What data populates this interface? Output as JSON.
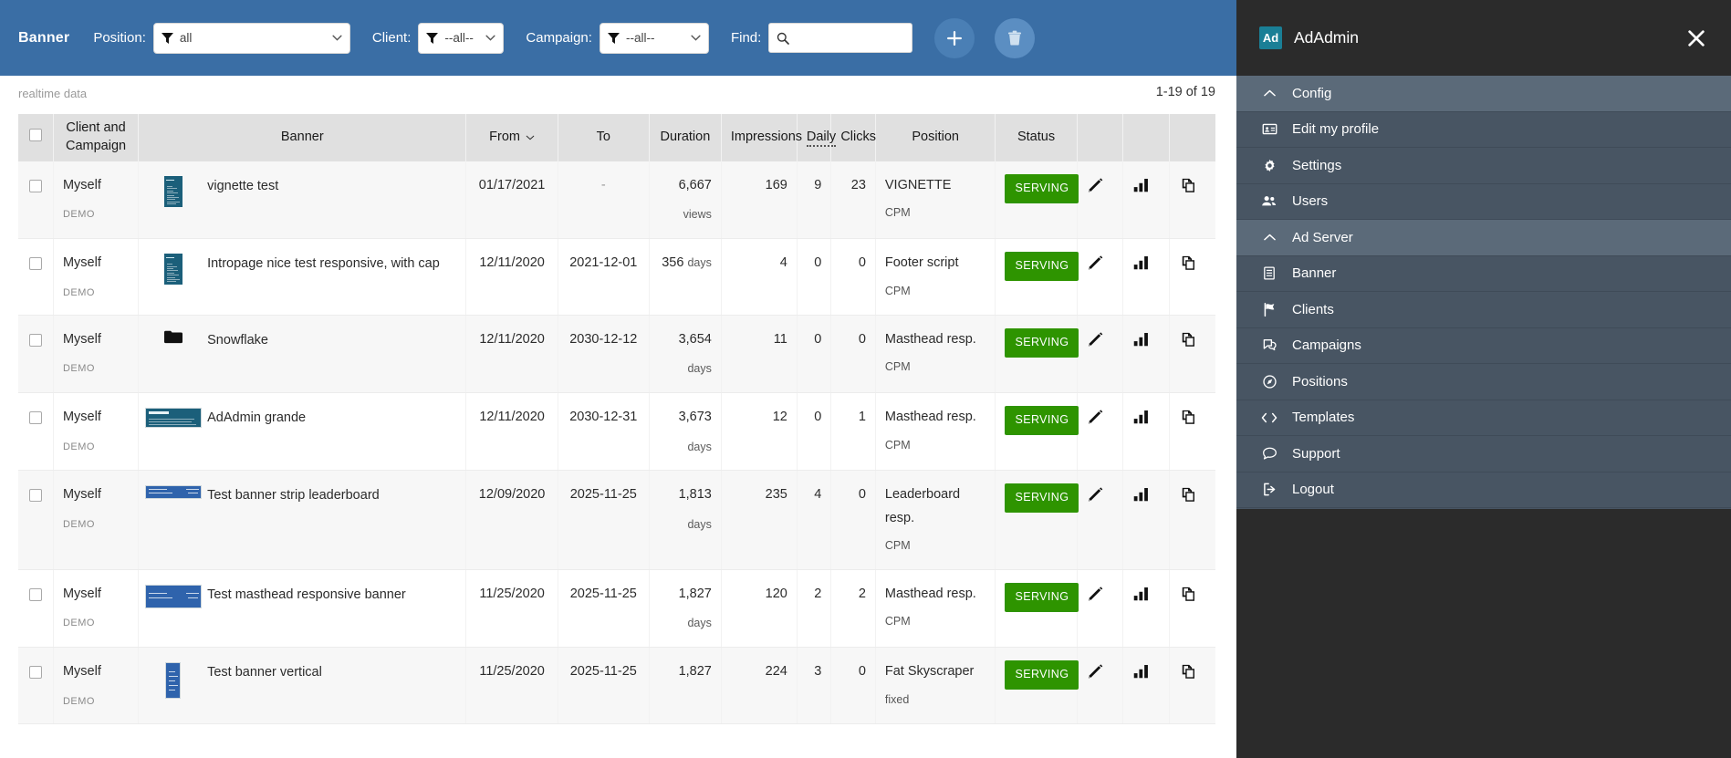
{
  "toolbar": {
    "title": "Banner",
    "position_label": "Position:",
    "position_value": "all",
    "client_label": "Client:",
    "client_value": "--all--",
    "campaign_label": "Campaign:",
    "campaign_value": "--all--",
    "find_label": "Find:",
    "find_value": "",
    "find_placeholder": "",
    "add_button": "+",
    "accent": "#3a6ea5"
  },
  "subheader": {
    "realtime": "realtime data",
    "pageinfo": "1-19 of 19"
  },
  "table": {
    "headers": {
      "client": "Client and Campaign",
      "client_line1": "Client and",
      "client_line2": "Campaign",
      "banner": "Banner",
      "from": "From",
      "to": "To",
      "duration": "Duration",
      "impressions": "Impressions",
      "daily": "Daily",
      "clicks": "Clicks",
      "position": "Position",
      "status": "Status"
    },
    "rows": [
      {
        "client": "Myself",
        "campaign": "DEMO",
        "thumb": "vertical-teal",
        "banner": "vignette test",
        "from": "01/17/2021",
        "to": "-",
        "duration": "6,667",
        "duration_unit": "views",
        "duration_inline": false,
        "impressions": "169",
        "daily": "9",
        "clicks": "23",
        "position": "VIGNETTE",
        "position_sub": "CPM",
        "status": "SERVING"
      },
      {
        "client": "Myself",
        "campaign": "DEMO",
        "thumb": "vertical-teal",
        "banner": "Intropage nice test responsive, with cap",
        "from": "12/11/2020",
        "to": "2021-12-01",
        "duration": "356",
        "duration_unit": "days",
        "duration_inline": true,
        "impressions": "4",
        "daily": "0",
        "clicks": "0",
        "position": "Footer script",
        "position_sub": "CPM",
        "status": "SERVING"
      },
      {
        "client": "Myself",
        "campaign": "DEMO",
        "thumb": "folder",
        "banner": "Snowflake",
        "from": "12/11/2020",
        "to": "2030-12-12",
        "duration": "3,654",
        "duration_unit": "days",
        "duration_inline": false,
        "impressions": "11",
        "daily": "0",
        "clicks": "0",
        "position": "Masthead resp.",
        "position_sub": "CPM",
        "status": "SERVING"
      },
      {
        "client": "Myself",
        "campaign": "DEMO",
        "thumb": "wide-teal",
        "banner": "AdAdmin grande",
        "from": "12/11/2020",
        "to": "2030-12-31",
        "duration": "3,673",
        "duration_unit": "days",
        "duration_inline": false,
        "impressions": "12",
        "daily": "0",
        "clicks": "1",
        "position": "Masthead resp.",
        "position_sub": "CPM",
        "status": "SERVING"
      },
      {
        "client": "Myself",
        "campaign": "DEMO",
        "thumb": "leaderboard",
        "banner": "Test banner strip leaderboard",
        "from": "12/09/2020",
        "to": "2025-11-25",
        "duration": "1,813",
        "duration_unit": "days",
        "duration_inline": false,
        "impressions": "235",
        "daily": "4",
        "clicks": "0",
        "position": "Leaderboard resp.",
        "position_sub": "CPM",
        "status": "SERVING"
      },
      {
        "client": "Myself",
        "campaign": "DEMO",
        "thumb": "masthead",
        "banner": "Test masthead responsive banner",
        "from": "11/25/2020",
        "to": "2025-11-25",
        "duration": "1,827",
        "duration_unit": "days",
        "duration_inline": false,
        "impressions": "120",
        "daily": "2",
        "clicks": "2",
        "position": "Masthead resp.",
        "position_sub": "CPM",
        "status": "SERVING"
      },
      {
        "client": "Myself",
        "campaign": "DEMO",
        "thumb": "skyscraper",
        "banner": "Test banner vertical",
        "from": "11/25/2020",
        "to": "2025-11-25",
        "duration": "1,827",
        "duration_unit": "",
        "duration_inline": false,
        "impressions": "224",
        "daily": "3",
        "clicks": "0",
        "position": "Fat Skyscraper",
        "position_sub": "fixed",
        "status": "SERVING"
      }
    ]
  },
  "sidebar": {
    "logo_text": "Ad",
    "brand": "AdAdmin",
    "items": [
      {
        "label": "Config",
        "icon": "chevron-up-icon",
        "group": true
      },
      {
        "label": "Edit my profile",
        "icon": "id-card-icon",
        "group": false
      },
      {
        "label": "Settings",
        "icon": "gear-icon",
        "group": false
      },
      {
        "label": "Users",
        "icon": "users-icon",
        "group": false
      },
      {
        "label": "Ad Server",
        "icon": "chevron-up-icon",
        "group": true
      },
      {
        "label": "Banner",
        "icon": "document-icon",
        "group": false
      },
      {
        "label": "Clients",
        "icon": "flag-icon",
        "group": false
      },
      {
        "label": "Campaigns",
        "icon": "campaign-icon",
        "group": false
      },
      {
        "label": "Positions",
        "icon": "compass-icon",
        "group": false
      },
      {
        "label": "Templates",
        "icon": "code-icon",
        "group": false
      },
      {
        "label": "Support",
        "icon": "chat-icon",
        "group": false
      },
      {
        "label": "Logout",
        "icon": "logout-icon",
        "group": false
      }
    ]
  }
}
